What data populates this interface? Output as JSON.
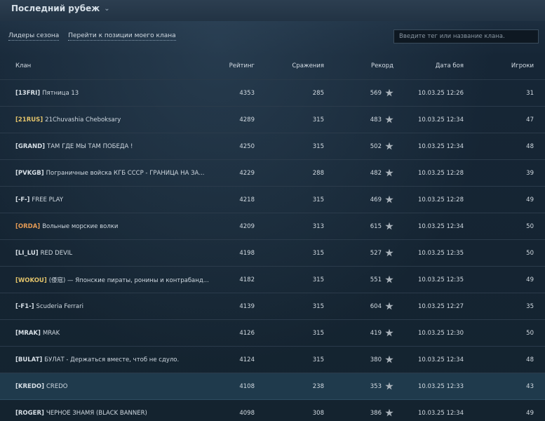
{
  "header": {
    "title": "Последний рубеж",
    "chevron": "⌄"
  },
  "nav": {
    "leaders": "Лидеры сезона",
    "goto": "Перейти к позиции моего клана"
  },
  "search": {
    "placeholder": "Введите тег или название клана."
  },
  "columns": {
    "clan": "Клан",
    "rating": "Рейтинг",
    "battles": "Сражения",
    "record": "Рекорд",
    "date": "Дата боя",
    "players": "Игроки"
  },
  "rows": [
    {
      "tag": "[13FRI]",
      "tag_color": "white",
      "name": "Пятница 13",
      "rating": "4353",
      "battles": "285",
      "record": "569",
      "date": "10.03.25 12:26",
      "players": "31"
    },
    {
      "tag": "[21RUS]",
      "tag_color": "gold",
      "name": "21Chuvashia Cheboksary",
      "rating": "4289",
      "battles": "315",
      "record": "483",
      "date": "10.03.25 12:34",
      "players": "47"
    },
    {
      "tag": "[GRAND]",
      "tag_color": "white",
      "name": "ТАМ ГДЕ МЫ ТАМ ПОБЕДА !",
      "rating": "4250",
      "battles": "315",
      "record": "502",
      "date": "10.03.25 12:34",
      "players": "48"
    },
    {
      "tag": "[PVKGB]",
      "tag_color": "white",
      "name": "Пограничные войска КГБ СССР - ГРАНИЦА НА ЗА...",
      "rating": "4229",
      "battles": "288",
      "record": "482",
      "date": "10.03.25 12:28",
      "players": "39"
    },
    {
      "tag": "[-F-]",
      "tag_color": "white",
      "name": "FREE PLAY",
      "rating": "4218",
      "battles": "315",
      "record": "469",
      "date": "10.03.25 12:28",
      "players": "49"
    },
    {
      "tag": "[ORDA]",
      "tag_color": "orange",
      "name": "Вольные морские волки",
      "rating": "4209",
      "battles": "313",
      "record": "615",
      "date": "10.03.25 12:34",
      "players": "50"
    },
    {
      "tag": "[LI_LU]",
      "tag_color": "white",
      "name": "RED DEVIL",
      "rating": "4198",
      "battles": "315",
      "record": "527",
      "date": "10.03.25 12:35",
      "players": "50"
    },
    {
      "tag": "[WOKOU]",
      "tag_color": "gold",
      "name": "(倭寇) — Японские пираты, ронины и контрабанд...",
      "rating": "4182",
      "battles": "315",
      "record": "551",
      "date": "10.03.25 12:35",
      "players": "49"
    },
    {
      "tag": "[-F1-]",
      "tag_color": "white",
      "name": "Scuderia Ferrari",
      "rating": "4139",
      "battles": "315",
      "record": "604",
      "date": "10.03.25 12:27",
      "players": "35"
    },
    {
      "tag": "[MRAK]",
      "tag_color": "white",
      "name": "MRAK",
      "rating": "4126",
      "battles": "315",
      "record": "419",
      "date": "10.03.25 12:30",
      "players": "50"
    },
    {
      "tag": "[BULAT]",
      "tag_color": "white",
      "name": "БУЛАТ - Держаться вместе, чтоб не сдуло.",
      "rating": "4124",
      "battles": "315",
      "record": "380",
      "date": "10.03.25 12:34",
      "players": "48"
    },
    {
      "tag": "[KREDO]",
      "tag_color": "white",
      "name": "CREDO",
      "rating": "4108",
      "battles": "238",
      "record": "353",
      "date": "10.03.25 12:33",
      "players": "43",
      "highlight": true
    },
    {
      "tag": "[ROGER]",
      "tag_color": "white",
      "name": "ЧЕРНОЕ ЗНАМЯ (BLACK BANNER)",
      "rating": "4098",
      "battles": "308",
      "record": "386",
      "date": "10.03.25 12:34",
      "players": "49"
    }
  ]
}
